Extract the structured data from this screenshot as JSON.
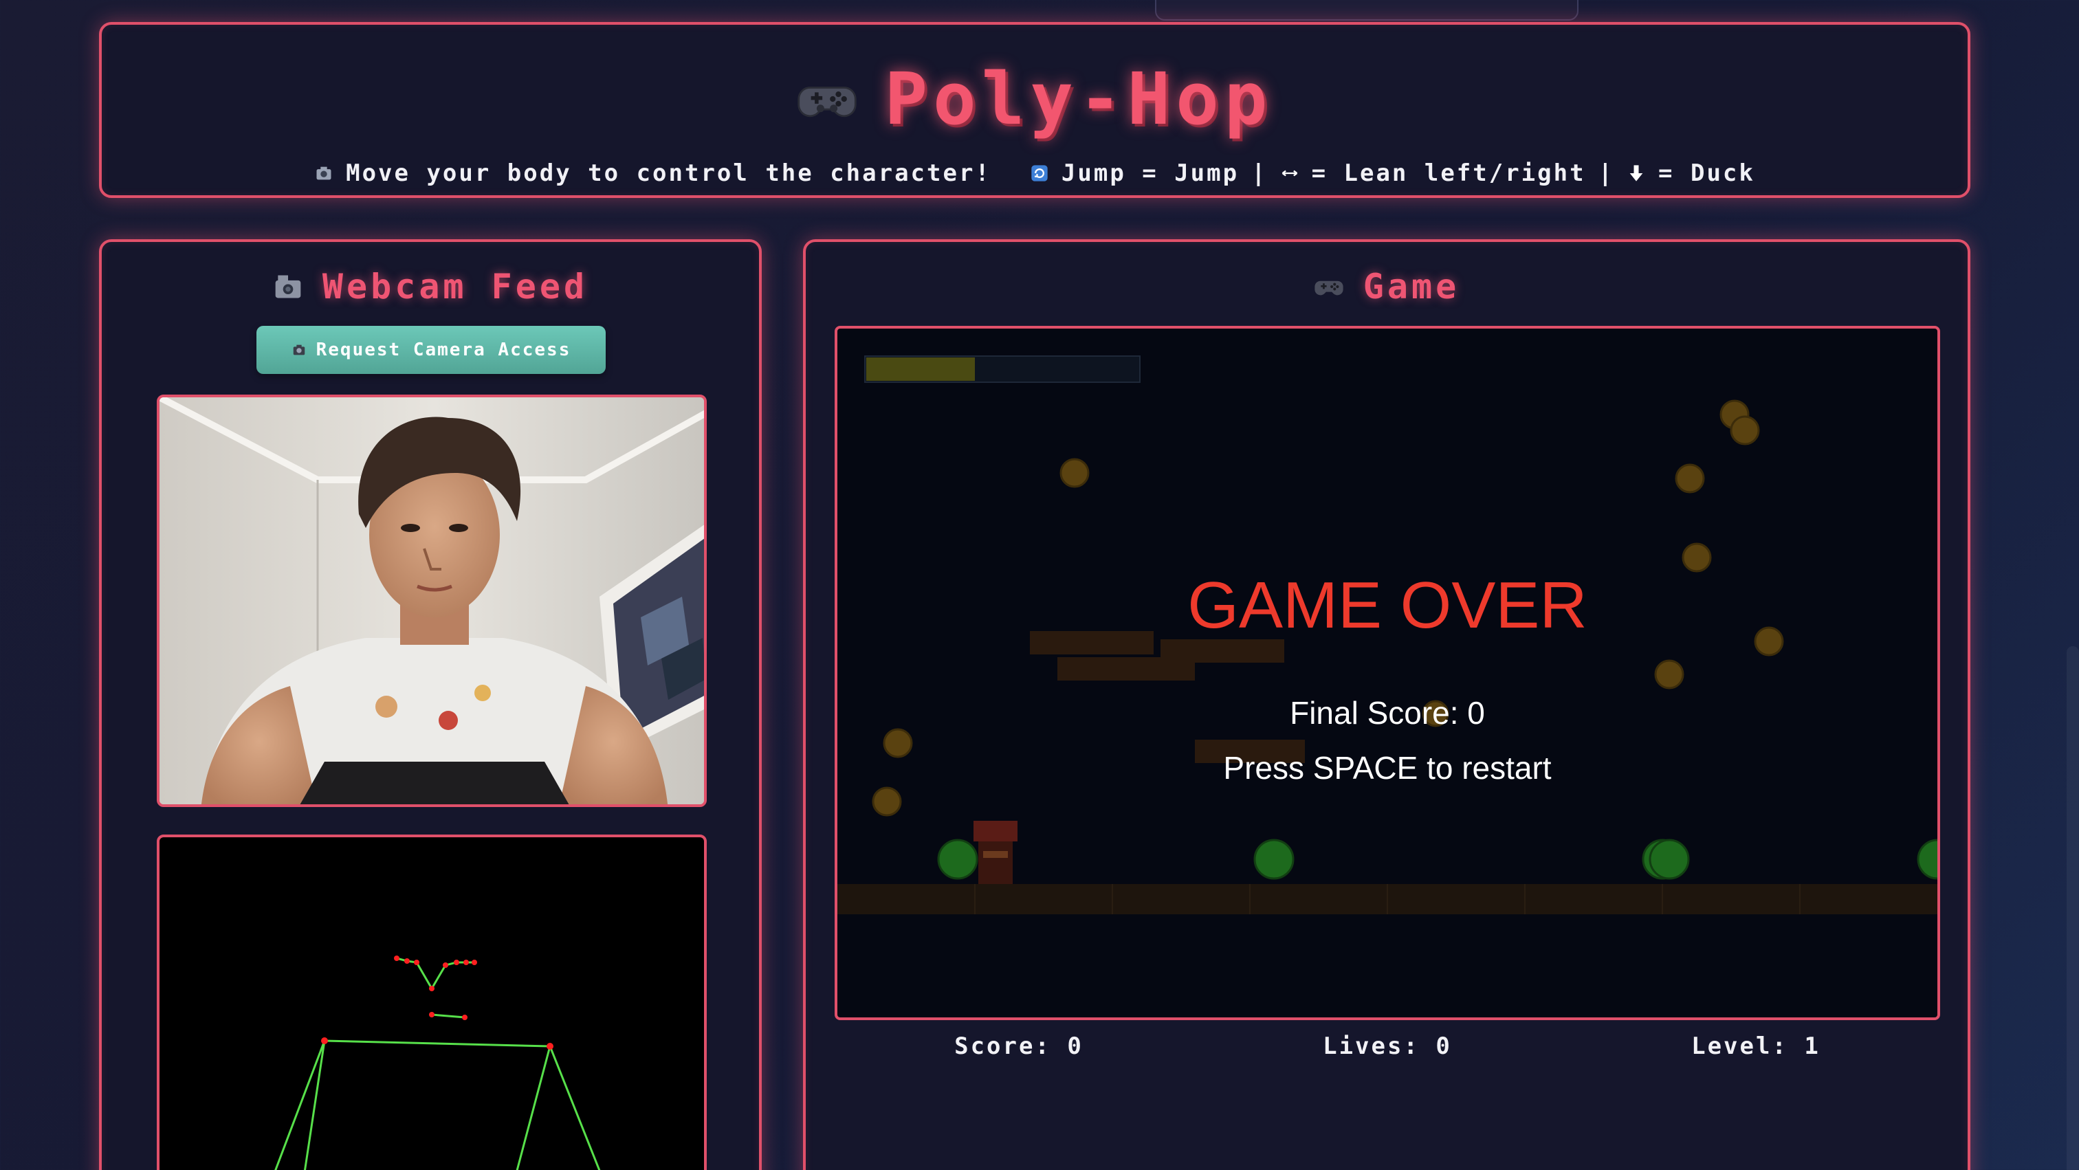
{
  "header": {
    "title": "Poly-Hop",
    "instruction_main": "Move your body to control the character!",
    "instruction_jump": "Jump = Jump",
    "instruction_lean": "= Lean left/right",
    "instruction_duck": "= Duck",
    "separator": "|"
  },
  "webcam": {
    "title": "Webcam Feed",
    "button_label": "Request Camera Access"
  },
  "game": {
    "title": "Game",
    "overlay_title": "GAME OVER",
    "final_score": "Final Score: 0",
    "restart_hint": "Press SPACE to restart",
    "progress_fraction": 0.4,
    "stats": {
      "score": "Score: 0",
      "lives": "Lives: 0",
      "level": "Level: 1"
    }
  },
  "colors": {
    "accent": "#e0506a",
    "title": "#f2566f",
    "button": "#5fb8a8",
    "game_over": "#ee3a2c",
    "skeleton": "#57e04a",
    "joint": "#ff2020"
  },
  "icons": {
    "title_icon": "gamepad-icon",
    "instruction_icon": "camera-icon",
    "jump_icon": "refresh-icon",
    "lean_icon": "left-right-arrow-icon",
    "duck_icon": "down-arrow-icon",
    "webcam_icon": "video-camera-icon",
    "game_icon": "gamepad-icon"
  }
}
